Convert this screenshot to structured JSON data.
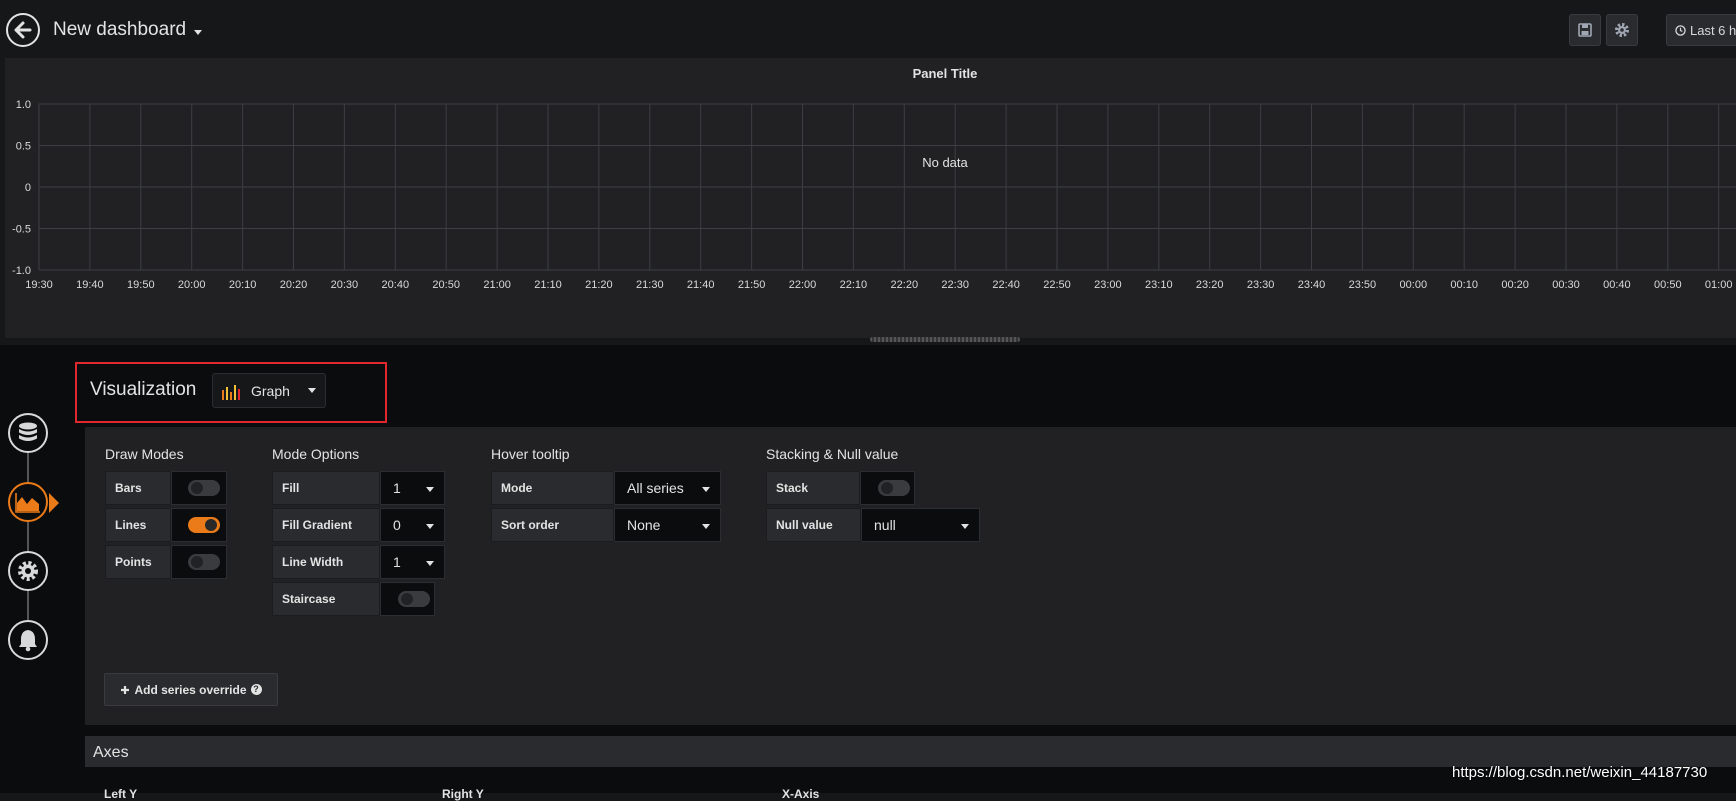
{
  "header": {
    "title": "New dashboard",
    "time_range": "Last 6 h"
  },
  "panel": {
    "title": "Panel Title",
    "no_data": "No data"
  },
  "chart_data": {
    "type": "line",
    "title": "Panel Title",
    "ylim": [
      -1.0,
      1.0
    ],
    "y_ticks": [
      "1.0",
      "0.5",
      "0",
      "-0.5",
      "-1.0"
    ],
    "x_ticks": [
      "19:30",
      "19:40",
      "19:50",
      "20:00",
      "20:10",
      "20:20",
      "20:30",
      "20:40",
      "20:50",
      "21:00",
      "21:10",
      "21:20",
      "21:30",
      "21:40",
      "21:50",
      "22:00",
      "22:10",
      "22:20",
      "22:30",
      "22:40",
      "22:50",
      "23:00",
      "23:10",
      "23:20",
      "23:30",
      "23:40",
      "23:50",
      "00:00",
      "00:10",
      "00:20",
      "00:30",
      "00:40",
      "00:50",
      "01:00"
    ],
    "series": [],
    "grid": true,
    "annotation": "No data"
  },
  "visualization": {
    "label": "Visualization",
    "selected": "Graph"
  },
  "draw_modes": {
    "title": "Draw Modes",
    "rows": [
      {
        "label": "Bars",
        "on": false
      },
      {
        "label": "Lines",
        "on": true
      },
      {
        "label": "Points",
        "on": false
      }
    ]
  },
  "mode_options": {
    "title": "Mode Options",
    "fill_label": "Fill",
    "fill_value": "1",
    "gradient_label": "Fill Gradient",
    "gradient_value": "0",
    "width_label": "Line Width",
    "width_value": "1",
    "staircase_label": "Staircase",
    "staircase_on": false
  },
  "hover_tooltip": {
    "title": "Hover tooltip",
    "mode_label": "Mode",
    "mode_value": "All series",
    "sort_label": "Sort order",
    "sort_value": "None"
  },
  "stacking": {
    "title": "Stacking & Null value",
    "stack_label": "Stack",
    "stack_on": false,
    "null_label": "Null value",
    "null_value": "null"
  },
  "add_override": "Add series override",
  "axes": {
    "title": "Axes",
    "left_y": "Left Y",
    "right_y": "Right Y",
    "x_axis": "X-Axis"
  },
  "watermark": "https://blog.csdn.net/weixin_44187730",
  "colors": {
    "accent": "#eb7b18",
    "highlight": "#e0282e"
  }
}
